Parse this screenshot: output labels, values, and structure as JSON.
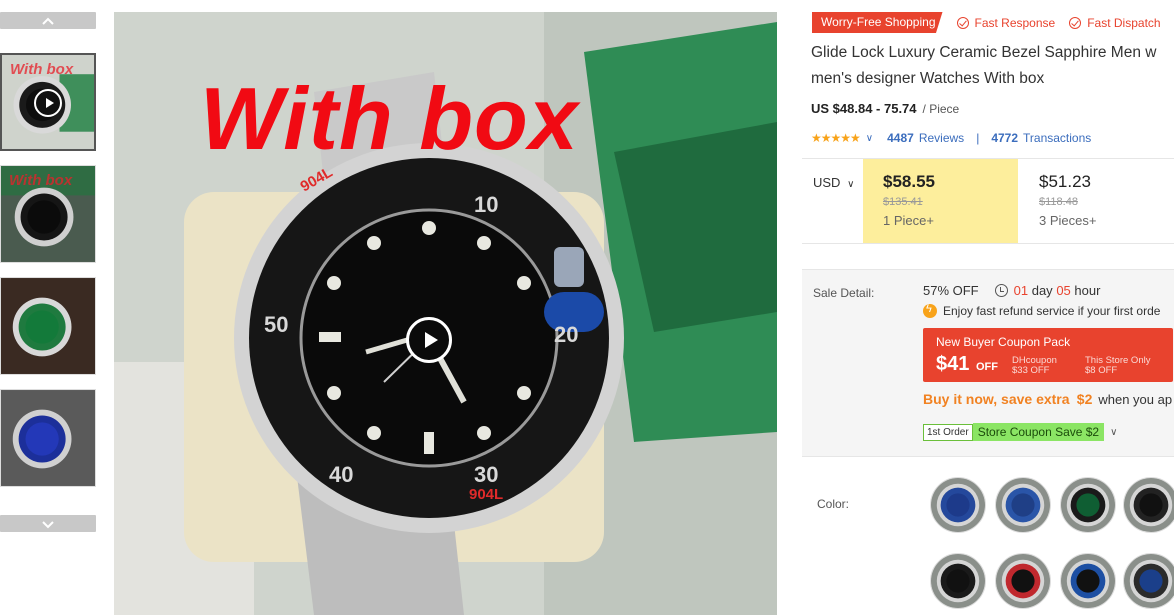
{
  "gallery": {
    "thumbnails": [
      {
        "kind": "video",
        "overlay": "With box"
      },
      {
        "kind": "image",
        "overlay": "With box"
      },
      {
        "kind": "image",
        "overlay": ""
      },
      {
        "kind": "image",
        "overlay": ""
      }
    ],
    "main_overlay": "With box",
    "icons": {
      "up": "chevron-up-icon",
      "down": "chevron-down-icon",
      "play": "play-icon"
    }
  },
  "product": {
    "badges": {
      "worry_free": "Worry-Free Shopping",
      "fast_response": "Fast Response",
      "fast_dispatch": "Fast Dispatch"
    },
    "title": "Glide Lock Luxury Ceramic Bezel Sapphire Men w men's designer Watches With box",
    "price_range": "US $48.84 - 75.74",
    "price_unit": "/ Piece",
    "rating": {
      "stars": "★★★★★",
      "reviews_count": "4487",
      "reviews_label": "Reviews",
      "transactions_count": "4772",
      "transactions_label": "Transactions"
    }
  },
  "pricing": {
    "currency": "USD",
    "tiers": [
      {
        "price": "$58.55",
        "original": "$135.41",
        "quantity": "1 Piece+"
      },
      {
        "price": "$51.23",
        "original": "$118.48",
        "quantity": "3 Pieces+"
      }
    ]
  },
  "sale": {
    "label": "Sale Detail:",
    "discount": "57% OFF",
    "days_num": "01",
    "days_label": "day",
    "hours_num": "05",
    "hours_label": "hour",
    "refund": "Enjoy fast refund service if your first orde",
    "coupon": {
      "title": "New Buyer Coupon Pack",
      "amount": "$41",
      "off": "OFF",
      "dh_label": "DHcoupon",
      "dh_value": "$33 OFF",
      "store_label": "This Store Only",
      "store_value": "$8 OFF"
    },
    "buy_more": "Buy it now, save extra",
    "buy_more_amount": "$2",
    "buy_more_rest": "when you ap",
    "first_order": "1st Order",
    "store_coupon": "Store Coupon Save $2"
  },
  "options": {
    "color_label": "Color:",
    "swatches": [
      {
        "dial": "#1d3a8a",
        "bezel": "#24489c"
      },
      {
        "dial": "#1f3f86",
        "bezel": "#2a55a8"
      },
      {
        "dial": "#0f5e33",
        "bezel": "#1a1a1a"
      },
      {
        "dial": "#111111",
        "bezel": "#222222"
      },
      {
        "dial": "#111111",
        "bezel": "#1a1a1a"
      },
      {
        "dial": "#111111",
        "bezel": "#c0282e"
      },
      {
        "dial": "#111111",
        "bezel": "#1d4fa3"
      },
      {
        "dial": "#1b3f8a",
        "bezel": "#2b2b2b"
      }
    ]
  }
}
